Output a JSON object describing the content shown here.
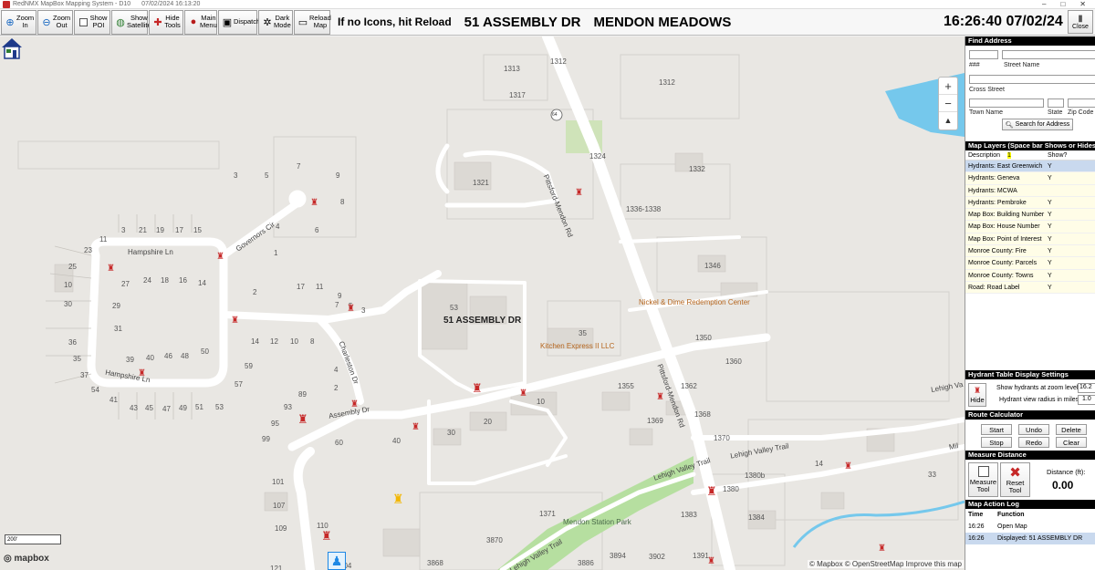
{
  "window": {
    "title": "RedNMX MapBox Mapping System - D10",
    "datetime": "07/02/2024 16:13:20",
    "controls": [
      "–",
      "□",
      "✕"
    ]
  },
  "toolbar": {
    "buttons": [
      {
        "label": "Zoom\nIn",
        "icon": "zoom-in-icon"
      },
      {
        "label": "Zoom\nOut",
        "icon": "zoom-out-icon"
      },
      {
        "label": "Show\nPOI",
        "icon": "poi-icon"
      },
      {
        "label": "Show\nSatellite",
        "icon": "satellite-icon"
      },
      {
        "label": "Hide\nTools",
        "icon": "tools-icon"
      },
      {
        "label": "Main\nMenu",
        "icon": "menu-icon"
      },
      {
        "label": "Dispatch",
        "icon": "dispatch-icon"
      },
      {
        "label": "Dark\nMode",
        "icon": "dark-mode-icon"
      },
      {
        "label": "Reload\nMap",
        "icon": "reload-icon"
      }
    ],
    "message": "If no Icons, hit Reload",
    "address": "51 ASSEMBLY DR",
    "area": "MENDON MEADOWS",
    "clock": "16:26:40 07/02/24",
    "close_label": "Close"
  },
  "map": {
    "selected_address_label": "51 ASSEMBLY DR",
    "scale_text": "200'",
    "attribution": "© Mapbox  © OpenStreetMap  Improve this map",
    "logo": "mapbox",
    "zoom_controls": [
      "+",
      "−",
      "▲"
    ],
    "route_shield": "64",
    "road_labels": [
      "Pittsford-Mendon Rd",
      "Pittsford-Mendon Rd",
      "Hampshire Ln",
      "Hampshire Ln",
      "Governors Cir",
      "Charleston Dr",
      "Assembly Dr",
      "Lehigh Valley Trail",
      "Lehigh Valley Trail",
      "Lehigh Valley Trail",
      "Lehigh Va",
      "Mil"
    ],
    "poi_labels": [
      "Nickel & Dime\nRedemption Center",
      "Kitchen Express II LLC"
    ],
    "park_label": "Mendon Station Park",
    "house_numbers": [
      "1313",
      "1312",
      "1317",
      "1312",
      "1324",
      "1321",
      "1332",
      "1336-1338",
      "1346",
      "1350",
      "1360",
      "1355",
      "1362",
      "1368",
      "1369",
      "1370",
      "1380b",
      "1380",
      "1383",
      "1384",
      "1391",
      "1371",
      "3870",
      "3886",
      "3894",
      "3902",
      "3868",
      "53",
      "35",
      "30",
      "20",
      "10",
      "14",
      "33",
      "3",
      "5",
      "7",
      "9",
      "8",
      "6",
      "4",
      "1",
      "2",
      "3",
      "21",
      "19",
      "17",
      "15",
      "11",
      "23",
      "25",
      "27",
      "24",
      "18",
      "16",
      "14",
      "10",
      "29",
      "30",
      "31",
      "36",
      "35",
      "37",
      "39",
      "40",
      "46",
      "48",
      "50",
      "54",
      "41",
      "43",
      "45",
      "47",
      "49",
      "51",
      "53",
      "57",
      "59",
      "14",
      "12",
      "10",
      "8",
      "17",
      "11",
      "9",
      "7",
      "5",
      "3",
      "4",
      "89",
      "93",
      "95",
      "99",
      "2",
      "60",
      "40",
      "101",
      "107",
      "109",
      "110",
      "121",
      "104"
    ]
  },
  "find_address": {
    "title": "Find Address",
    "hash_label": "###",
    "street_label": "Street Name",
    "cross_label": "Cross Street",
    "town_label": "Town Name",
    "state_label": "State",
    "zip_label": "Zip Code",
    "search_label": "Search for Address"
  },
  "map_layers": {
    "title": "Map Layers (Space bar Shows or Hides)",
    "col_desc": "Description",
    "col_show": "Show?",
    "sort_marker": "1",
    "rows": [
      {
        "desc": "Hydrants:  East Greenwich",
        "show": "Y"
      },
      {
        "desc": "Hydrants:  Geneva",
        "show": "Y"
      },
      {
        "desc": "Hydrants:  MCWA",
        "show": ""
      },
      {
        "desc": "Hydrants:  Pembroke",
        "show": "Y"
      },
      {
        "desc": "Map Box:  Building Number",
        "show": "Y"
      },
      {
        "desc": "Map Box:  House Number",
        "show": "Y"
      },
      {
        "desc": "Map Box:  Point of Interest",
        "show": "Y"
      },
      {
        "desc": "Monroe County:  Fire",
        "show": "Y"
      },
      {
        "desc": "Monroe County:  Parcels",
        "show": "Y"
      },
      {
        "desc": "Monroe County:  Towns",
        "show": "Y"
      },
      {
        "desc": "Road:  Road Label",
        "show": "Y"
      }
    ]
  },
  "hydrant_table": {
    "title": "Hydrant Table Display Settings",
    "hide_label": "Hide",
    "zoom_label": "Show hydrants at zoom level",
    "zoom_value": "16.2",
    "radius_label": "Hydrant view radius in miles",
    "radius_value": "1.0"
  },
  "route_calc": {
    "title": "Route Calculator",
    "buttons": [
      "Start",
      "Undo",
      "Delete",
      "Stop",
      "Redo",
      "Clear"
    ]
  },
  "measure": {
    "title": "Measure Distance",
    "measure_label": "Measure\nTool",
    "reset_label": "Reset\nTool",
    "distance_label": "Distance (ft):",
    "distance_value": "0.00"
  },
  "action_log": {
    "title": "Map Action Log",
    "col_time": "Time",
    "col_function": "Function",
    "rows": [
      {
        "time": "16:26",
        "function": "Open Map"
      },
      {
        "time": "16:26",
        "function": "Displayed: 51 ASSEMBLY DR"
      }
    ]
  }
}
